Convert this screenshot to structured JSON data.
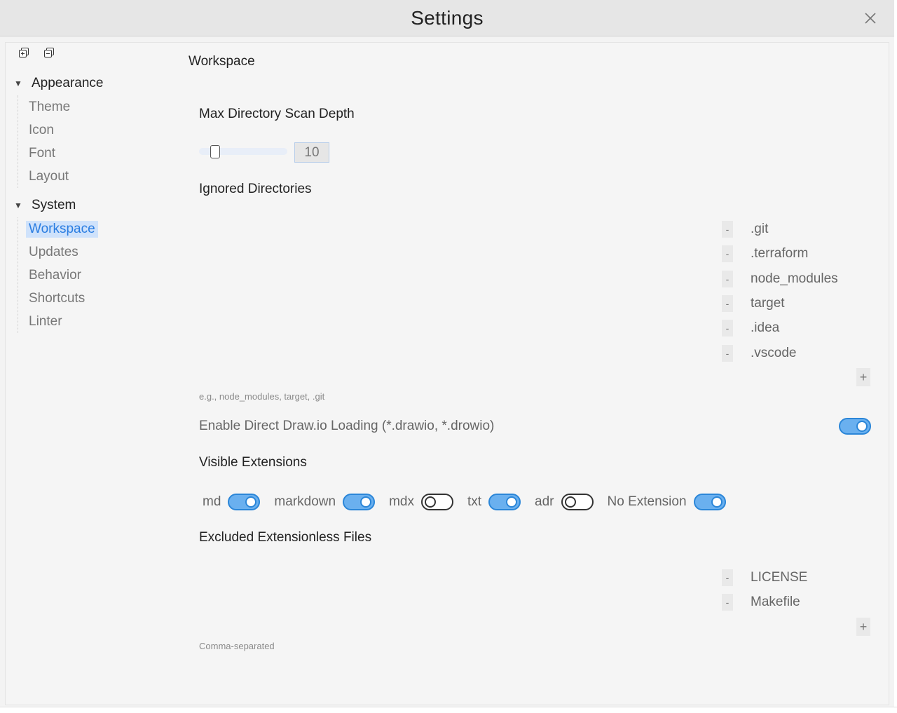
{
  "window": {
    "title": "Settings",
    "close_icon": "close-icon"
  },
  "toolbar": {
    "icons": [
      "expand-all-icon",
      "collapse-all-icon"
    ]
  },
  "sidebar": {
    "groups": [
      {
        "label": "Appearance",
        "expanded": true,
        "items": [
          {
            "label": "Theme"
          },
          {
            "label": "Icon"
          },
          {
            "label": "Font"
          },
          {
            "label": "Layout"
          }
        ]
      },
      {
        "label": "System",
        "expanded": true,
        "items": [
          {
            "label": "Workspace",
            "active": true
          },
          {
            "label": "Updates"
          },
          {
            "label": "Behavior"
          },
          {
            "label": "Shortcuts"
          },
          {
            "label": "Linter"
          }
        ]
      }
    ]
  },
  "main": {
    "section_title": "Workspace",
    "scan_depth": {
      "label": "Max Directory Scan Depth",
      "value": "10",
      "slider_fraction": 0.14
    },
    "ignored_dirs": {
      "label": "Ignored Directories",
      "items": [
        ".git",
        ".terraform",
        "node_modules",
        "target",
        ".idea",
        ".vscode"
      ],
      "minus_label": "-",
      "plus_label": "+",
      "hint": "e.g., node_modules, target, .git"
    },
    "drawio": {
      "label": "Enable Direct Draw.io Loading (*.drawio, *.drowio)",
      "enabled": true
    },
    "visible_ext": {
      "label": "Visible Extensions",
      "items": [
        {
          "label": "md",
          "on": true
        },
        {
          "label": "markdown",
          "on": true
        },
        {
          "label": "mdx",
          "on": false
        },
        {
          "label": "txt",
          "on": true
        },
        {
          "label": "adr",
          "on": false
        },
        {
          "label": "No Extension",
          "on": true
        }
      ]
    },
    "excluded_files": {
      "label": "Excluded Extensionless Files",
      "items": [
        "LICENSE",
        "Makefile"
      ],
      "minus_label": "-",
      "plus_label": "+",
      "hint": "Comma-separated"
    }
  },
  "colors": {
    "accent": "#2b86d8",
    "toggle_on_fill": "#6ab0ef",
    "active_item_bg": "#cfe2fb"
  }
}
